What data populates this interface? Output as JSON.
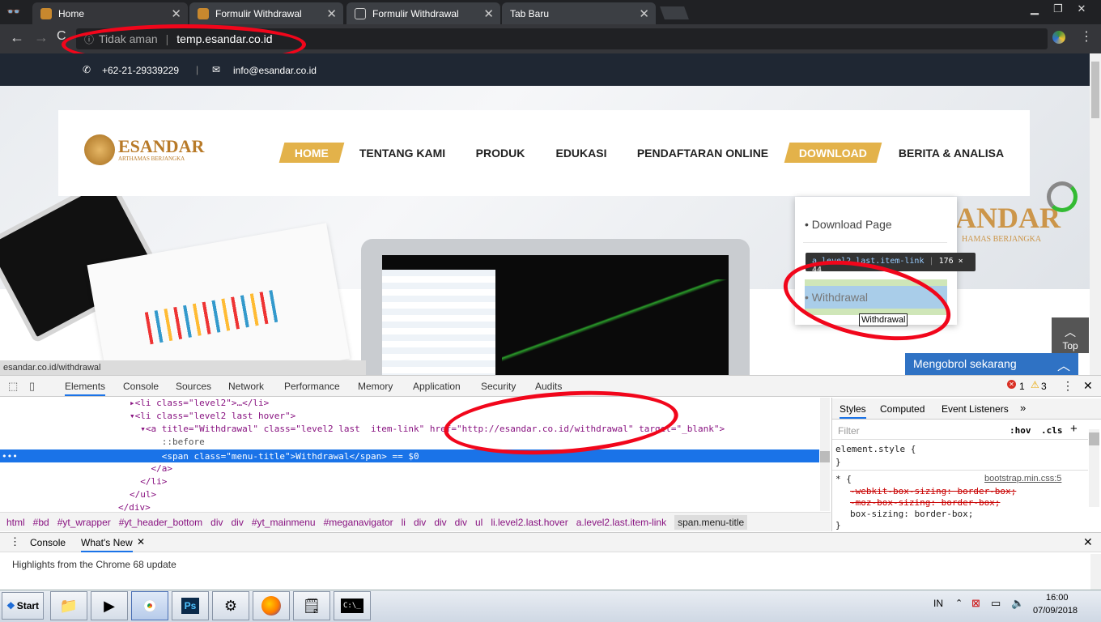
{
  "tabs": [
    {
      "title": "Home"
    },
    {
      "title": "Formulir Withdrawal"
    },
    {
      "title": "Formulir Withdrawal"
    },
    {
      "title": "Tab Baru"
    }
  ],
  "omnibox": {
    "security": "Tidak aman",
    "url": "temp.esandar.co.id"
  },
  "site": {
    "phone": "+62-21-29339229",
    "email": "info@esandar.co.id",
    "logo": "ESANDAR",
    "logo_sub": "ARTHAMAS BERJANGKA",
    "menu": [
      "HOME",
      "TENTANG KAMI",
      "PRODUK",
      "EDUKASI",
      "PENDAFTARAN ONLINE",
      "DOWNLOAD",
      "BERITA & ANALISA"
    ],
    "dropdown": [
      "Download Page",
      "Withdrawal"
    ],
    "tooltip_el": "a.level2.last.item-link",
    "tooltip_size": "176 × 44",
    "hover_title": "Withdrawal",
    "status_url": "esandar.co.id/withdrawal",
    "chat": "Mengobrol sekarang",
    "top": "Top",
    "wm1": "ANDAR",
    "wm2": "HAMAS BERJANGKA"
  },
  "devtools": {
    "tabs": [
      "Elements",
      "Console",
      "Sources",
      "Network",
      "Performance",
      "Memory",
      "Application",
      "Security",
      "Audits"
    ],
    "errors": "1",
    "warnings": "3",
    "code": [
      "▸<li class=\"level2\">…</li>",
      "▾<li class=\"level2 last hover\">",
      "  ▾<a title=\"Withdrawal\" class=\"level2 last  item-link\" href=\"http://esandar.co.id/withdrawal\" target=\"_blank\">",
      "      ::before",
      "      <span class=\"menu-title\">Withdrawal</span> == $0",
      "    </a>",
      "  </li>",
      "</ul>",
      "</div>"
    ],
    "breadcrumbs": [
      "html",
      "#bd",
      "#yt_wrapper",
      "#yt_header_bottom",
      "div",
      "div",
      "#yt_mainmenu",
      "#meganavigator",
      "li",
      "div",
      "div",
      "div",
      "ul",
      "li.level2.last.hover",
      "a.level2.last.item-link",
      "span.menu-title"
    ],
    "styles_tabs": [
      "Styles",
      "Computed",
      "Event Listeners"
    ],
    "filter": "Filter",
    "hov": ":hov",
    "cls": ".cls",
    "styles": [
      "element.style {",
      "}",
      "* {",
      "-webkit-box-sizing: border-box;",
      "-moz-box-sizing: border-box;",
      "box-sizing: border-box;",
      "}"
    ],
    "style_src": "bootstrap.min.css:5",
    "drawer_tabs": [
      "Console",
      "What's New"
    ],
    "drawer_text": "Highlights from the Chrome 68 update"
  },
  "taskbar": {
    "start": "Start",
    "lang": "IN",
    "time": "16:00",
    "date": "07/09/2018",
    "ps": "Ps",
    "cmd": "C:\\_"
  }
}
